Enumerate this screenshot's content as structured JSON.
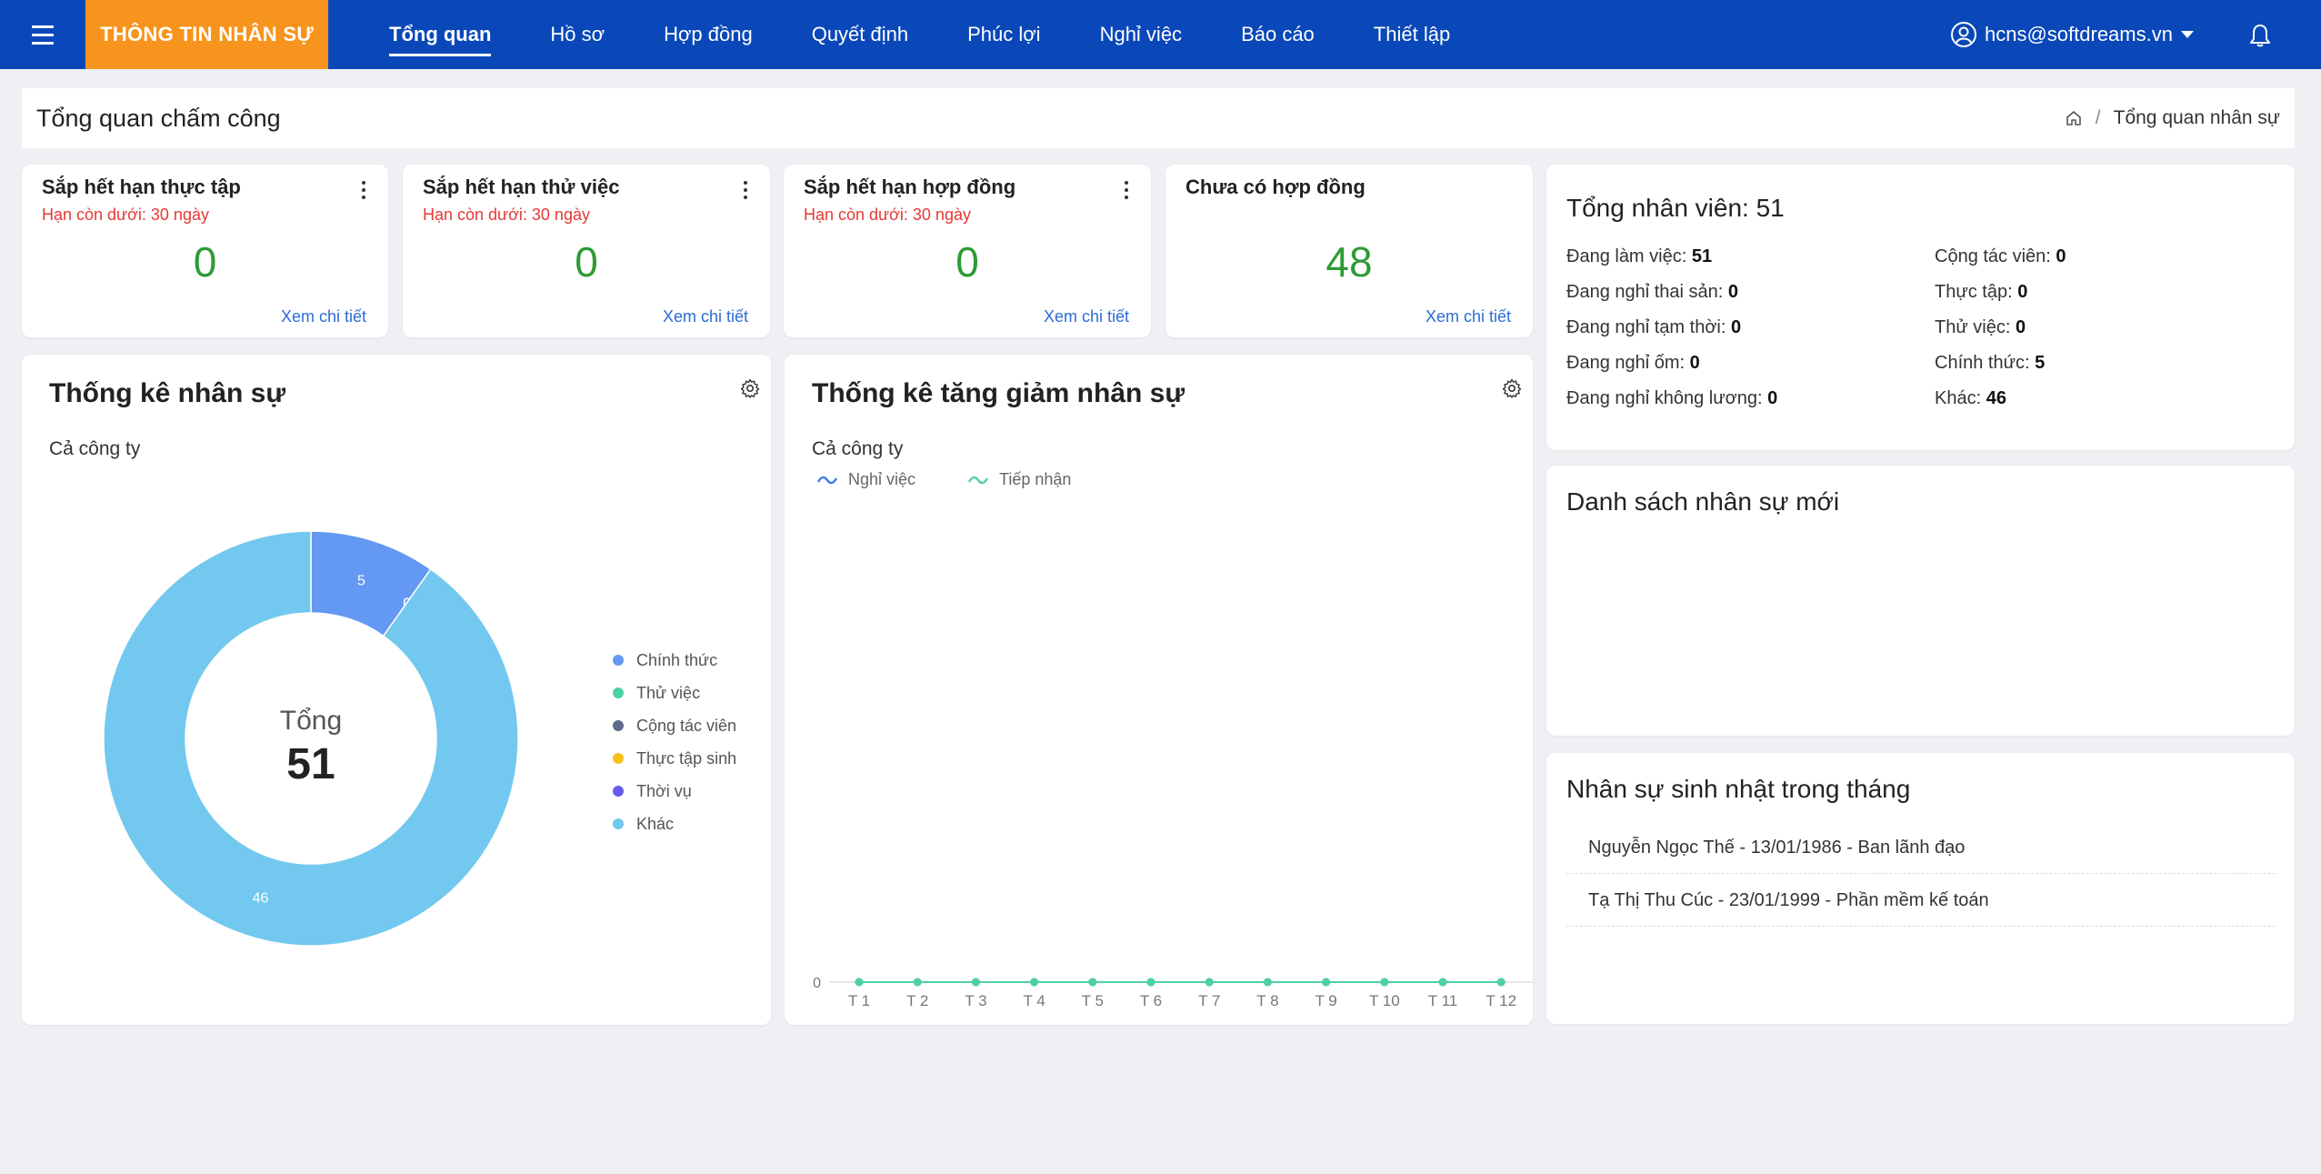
{
  "nav": {
    "brand": "THÔNG TIN NHÂN SỰ",
    "items": [
      {
        "label": "Tổng quan",
        "active": true
      },
      {
        "label": "Hồ sơ",
        "active": false
      },
      {
        "label": "Hợp đồng",
        "active": false
      },
      {
        "label": "Quyết định",
        "active": false
      },
      {
        "label": "Phúc lợi",
        "active": false
      },
      {
        "label": "Nghỉ việc",
        "active": false
      },
      {
        "label": "Báo cáo",
        "active": false
      },
      {
        "label": "Thiết lập",
        "active": false
      }
    ],
    "user": "hcns@softdreams.vn",
    "colors": {
      "nav_bg": "#0a48b9",
      "brand_bg": "#f7941d"
    }
  },
  "header": {
    "title": "Tổng quan chấm công",
    "breadcrumb": "Tổng quan nhân sự"
  },
  "stat_cards": [
    {
      "title": "Sắp hết hạn thực tập",
      "subtitle": "Hạn còn dưới: 30 ngày",
      "value": "0",
      "link": "Xem chi tiết"
    },
    {
      "title": "Sắp hết hạn thử việc",
      "subtitle": "Hạn còn dưới: 30 ngày",
      "value": "0",
      "link": "Xem chi tiết"
    },
    {
      "title": "Sắp hết hạn hợp đồng",
      "subtitle": "Hạn còn dưới: 30 ngày",
      "value": "0",
      "link": "Xem chi tiết"
    },
    {
      "title": "Chưa có hợp đồng",
      "subtitle": "",
      "value": "48",
      "link": "Xem chi tiết"
    }
  ],
  "staff_stats": {
    "title": "Thống kê nhân sự",
    "scope": "Cả công ty",
    "center_label": "Tổng",
    "center_value": "51"
  },
  "change_stats": {
    "title": "Thống kê tăng giảm nhân sự",
    "scope": "Cả công ty"
  },
  "total_staff": {
    "title": "Tổng nhân viên: 51",
    "left": [
      {
        "label": "Đang làm việc: ",
        "value": "51"
      },
      {
        "label": "Đang nghỉ thai sản: ",
        "value": "0"
      },
      {
        "label": "Đang nghỉ tạm thời: ",
        "value": "0"
      },
      {
        "label": "Đang nghỉ ốm: ",
        "value": "0"
      },
      {
        "label": "Đang nghỉ không lương: ",
        "value": "0"
      }
    ],
    "right": [
      {
        "label": "Cộng tác viên: ",
        "value": "0"
      },
      {
        "label": "Thực tập: ",
        "value": "0"
      },
      {
        "label": "Thử việc: ",
        "value": "0"
      },
      {
        "label": "Chính thức: ",
        "value": "5"
      },
      {
        "label": "Khác: ",
        "value": "46"
      }
    ]
  },
  "new_staff": {
    "title": "Danh sách nhân sự mới"
  },
  "birthdays": {
    "title": "Nhân sự sinh nhật trong tháng",
    "items": [
      "Nguyễn Ngọc Thế - 13/01/1986 - Ban lãnh đạo",
      "Tạ Thị Thu Cúc - 23/01/1999 - Phần mềm kế toán"
    ]
  },
  "chart_data": [
    {
      "type": "pie",
      "labels": [
        "Chính thức",
        "Thử việc",
        "Cộng tác viên",
        "Thực tập sinh",
        "Thời vụ",
        "Khác"
      ],
      "values": [
        5,
        0,
        0,
        0,
        0,
        46
      ],
      "colors": [
        "#6398f3",
        "#4ed0a3",
        "#5a6b8c",
        "#f5c218",
        "#6a5cf0",
        "#72c8ee"
      ],
      "legend": "right"
    },
    {
      "type": "line",
      "categories": [
        "T 1",
        "T 2",
        "T 3",
        "T 4",
        "T 5",
        "T 6",
        "T 7",
        "T 8",
        "T 9",
        "T 10",
        "T 11",
        "T 12"
      ],
      "series": [
        {
          "name": "Nghỉ việc",
          "values": [
            0,
            0,
            0,
            0,
            0,
            0,
            0,
            0,
            0,
            0,
            0,
            0
          ],
          "color": "#3a7bec"
        },
        {
          "name": "Tiếp nhận",
          "values": [
            0,
            0,
            0,
            0,
            0,
            0,
            0,
            0,
            0,
            0,
            0,
            0
          ],
          "color": "#4ed0a3"
        }
      ],
      "y_tick": "0",
      "legend": "top-left"
    }
  ]
}
